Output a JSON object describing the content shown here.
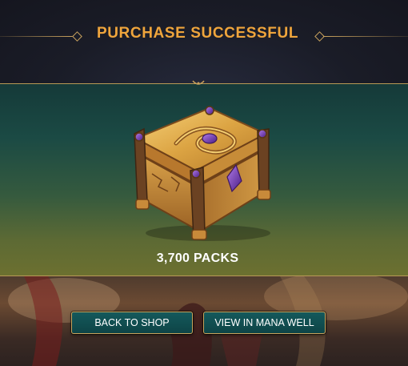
{
  "header": {
    "title": "PURCHASE SUCCESSFUL"
  },
  "reward": {
    "icon": "treasure-chest-icon",
    "label": "3,700 PACKS"
  },
  "buttons": {
    "back_label": "BACK TO SHOP",
    "view_label": "VIEW IN MANA WELL"
  },
  "colors": {
    "title": "#efa53c",
    "gold_border": "#c8a45c",
    "button_fill": "#0e4446",
    "panel_top": "#153a39",
    "panel_bottom": "#6c7030"
  }
}
